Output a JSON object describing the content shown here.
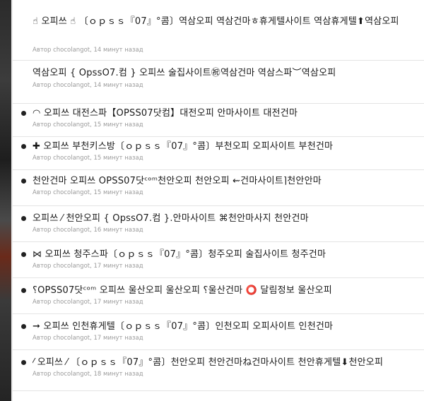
{
  "items": [
    {
      "title": "☝ 오피쓰 ☝ 〔ｏｐｓｓ『07』°콤〕역삼오피 역삼건마ㅎ휴게텔사이트 역삼휴게텔⬆역삼오피",
      "author_prefix": "Автор",
      "author": "chocolangot",
      "time": "14 минут назад",
      "bullet": false
    },
    {
      "title": "역삼오피 { OpssO7.컴 } 오피쓰 술집사이트㊗역삼건마 역삼스파︶역삼오피",
      "author_prefix": "Автор",
      "author": "chocolangot",
      "time": "14 минут назад",
      "bullet": false
    },
    {
      "title": "◠ 오피쓰 대전스파【OPSS07닷컴】대전오피 안마사이트 대전건마",
      "author_prefix": "Автор",
      "author": "chocolangot",
      "time": "15 минут назад",
      "bullet": true
    },
    {
      "title": "✚ 오피쓰 부천키스방〔ｏｐｓｓ『07』°콤〕부천오피 오피사이트 부천건마",
      "author_prefix": "Автор",
      "author": "chocolangot",
      "time": "15 минут назад",
      "bullet": true
    },
    {
      "title": "천안건마 오피쓰 OPSS07닷ᶜᵒᵐ천안오피 천안오피 ⇜건마사이트⌉천안안마",
      "author_prefix": "Автор",
      "author": "chocolangot",
      "time": "15 минут назад",
      "bullet": true
    },
    {
      "title": "오피쓰 ⁄ 천안오피 { OpssO7.컴 }.안마사이트 ⌘천안마사지 천안건마",
      "author_prefix": "Автор",
      "author": "chocolangot",
      "time": "16 минут назад",
      "bullet": true
    },
    {
      "title": "⋈ 오피쓰 청주스파〔ｏｐｓｓ『07』°콤〕청주오피 술집사이트 청주건마",
      "author_prefix": "Автор",
      "author": "chocolangot",
      "time": "17 минут назад",
      "bullet": true
    },
    {
      "title": "⸮OPSS07닷ᶜᵒᵐ 오피쓰 울산오피 울산오피 ⸮울산건마 ⭕ 달림정보 울산오피",
      "author_prefix": "Автор",
      "author": "chocolangot",
      "time": "17 минут назад",
      "bullet": true
    },
    {
      "title": "➞ 오피쓰 인천휴게텔〔ｏｐｓｓ『07』°콤〕인천오피 오피사이트 인천건마",
      "author_prefix": "Автор",
      "author": "chocolangot",
      "time": "17 минут назад",
      "bullet": true
    },
    {
      "title": "⁄ 오피쓰 ⁄ 〔ｏｐｓｓ『07』°콤〕천안오피 천안건마ね건마사이트 천안휴게텔⬇천안오피",
      "author_prefix": "Автор",
      "author": "chocolangot",
      "time": "18 минут назад",
      "bullet": true
    }
  ]
}
